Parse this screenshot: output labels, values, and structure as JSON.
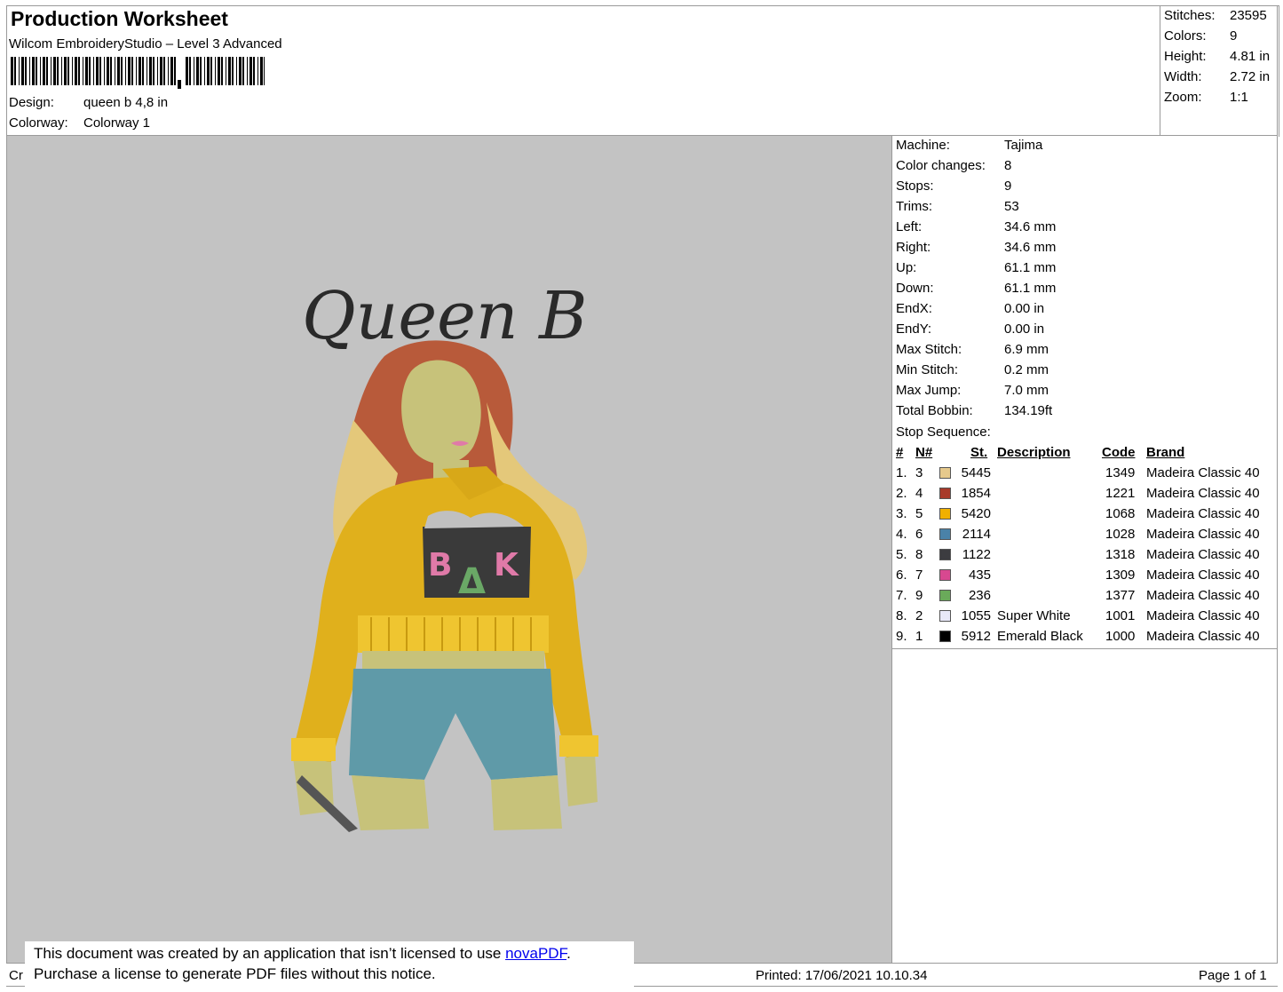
{
  "header": {
    "title": "Production Worksheet",
    "subtitle": "Wilcom EmbroideryStudio – Level 3 Advanced",
    "design_label": "Design:",
    "design_value": "queen b 4,8 in",
    "colorway_label": "Colorway:",
    "colorway_value": "Colorway 1"
  },
  "summary": [
    {
      "label": "Stitches:",
      "value": "23595"
    },
    {
      "label": "Colors:",
      "value": "9"
    },
    {
      "label": "Height:",
      "value": "4.81 in"
    },
    {
      "label": "Width:",
      "value": "2.72 in"
    },
    {
      "label": "Zoom:",
      "value": "1:1"
    }
  ],
  "preview": {
    "design_text": "Queen B",
    "badge_letters": [
      "B",
      "Δ",
      "K"
    ],
    "colors": {
      "background": "#c3c3c3",
      "hoodie": "#e0b01c",
      "skin": "#c7c27a",
      "hair": "#b85a3a",
      "hair_light": "#e4c87a",
      "shorts": "#5f9aa8",
      "pink": "#e07aa8",
      "green": "#6aa866",
      "dark": "#3a3a3a"
    }
  },
  "machine": [
    {
      "label": "Machine:",
      "value": "Tajima"
    },
    {
      "label": "Color changes:",
      "value": "8"
    },
    {
      "label": "Stops:",
      "value": "9"
    },
    {
      "label": "Trims:",
      "value": "53"
    },
    {
      "label": "Left:",
      "value": "34.6 mm"
    },
    {
      "label": "Right:",
      "value": "34.6 mm"
    },
    {
      "label": "Up:",
      "value": "61.1 mm"
    },
    {
      "label": "Down:",
      "value": "61.1 mm"
    },
    {
      "label": "EndX:",
      "value": "0.00 in"
    },
    {
      "label": "EndY:",
      "value": "0.00 in"
    },
    {
      "label": "Max Stitch:",
      "value": "6.9 mm"
    },
    {
      "label": "Min Stitch:",
      "value": "0.2 mm"
    },
    {
      "label": "Max Jump:",
      "value": "7.0 mm"
    },
    {
      "label": "Total Bobbin:",
      "value": "134.19ft"
    }
  ],
  "stop_sequence": {
    "title": "Stop Sequence:",
    "headers": {
      "num": "#",
      "n": "N#",
      "st": "St.",
      "desc": "Description",
      "code": "Code",
      "brand": "Brand"
    },
    "rows": [
      {
        "num": "1.",
        "n": "3",
        "color": "#e6c98c",
        "st": "5445",
        "desc": "",
        "code": "1349",
        "brand": "Madeira Classic 40"
      },
      {
        "num": "2.",
        "n": "4",
        "color": "#a83a2a",
        "st": "1854",
        "desc": "",
        "code": "1221",
        "brand": "Madeira Classic 40"
      },
      {
        "num": "3.",
        "n": "5",
        "color": "#f0b000",
        "st": "5420",
        "desc": "",
        "code": "1068",
        "brand": "Madeira Classic 40"
      },
      {
        "num": "4.",
        "n": "6",
        "color": "#4a82a8",
        "st": "2114",
        "desc": "",
        "code": "1028",
        "brand": "Madeira Classic 40"
      },
      {
        "num": "5.",
        "n": "8",
        "color": "#3c3c40",
        "st": "1122",
        "desc": "",
        "code": "1318",
        "brand": "Madeira Classic 40"
      },
      {
        "num": "6.",
        "n": "7",
        "color": "#d84890",
        "st": "435",
        "desc": "",
        "code": "1309",
        "brand": "Madeira Classic 40"
      },
      {
        "num": "7.",
        "n": "9",
        "color": "#6aaa5a",
        "st": "236",
        "desc": "",
        "code": "1377",
        "brand": "Madeira Classic 40"
      },
      {
        "num": "8.",
        "n": "2",
        "color": "#e8e8f8",
        "st": "1055",
        "desc": "Super White",
        "code": "1001",
        "brand": "Madeira Classic 40"
      },
      {
        "num": "9.",
        "n": "1",
        "color": "#000000",
        "st": "5912",
        "desc": "Emerald Black",
        "code": "1000",
        "brand": "Madeira Classic 40"
      }
    ]
  },
  "notice": {
    "line1_prefix": "This document was created by an application that isn’t licensed to use ",
    "link": "novaPDF",
    "line1_suffix": ".",
    "line2": "Purchase a license to generate PDF files without this notice."
  },
  "footer": {
    "cr": "Cr",
    "printed": "Printed: 17/06/2021 10.10.34",
    "page": "Page 1 of 1"
  }
}
